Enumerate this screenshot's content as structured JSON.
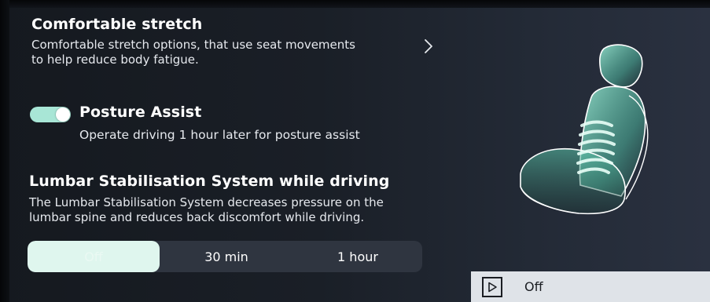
{
  "stretch": {
    "title": "Comfortable stretch",
    "desc_line1": "Comfortable stretch options, that use seat movements",
    "desc_line2": "to help reduce body fatigue."
  },
  "posture": {
    "title": "Posture Assist",
    "desc": "Operate driving 1 hour later for posture assist",
    "enabled": true
  },
  "lumbar": {
    "title": "Lumbar Stabilisation System while driving",
    "desc_line1": "The Lumbar Stabilisation System decreases pressure on the",
    "desc_line2": "lumbar spine and reduces back discomfort while driving.",
    "options": [
      "Off",
      "30 min",
      "1 hour"
    ],
    "selected": "Off"
  },
  "media": {
    "status": "Off",
    "icon": "play-icon"
  },
  "colors": {
    "accent": "#a8e6d6",
    "segment_selected": "#dff6ee",
    "seat_glow": "#7fe3c8"
  }
}
